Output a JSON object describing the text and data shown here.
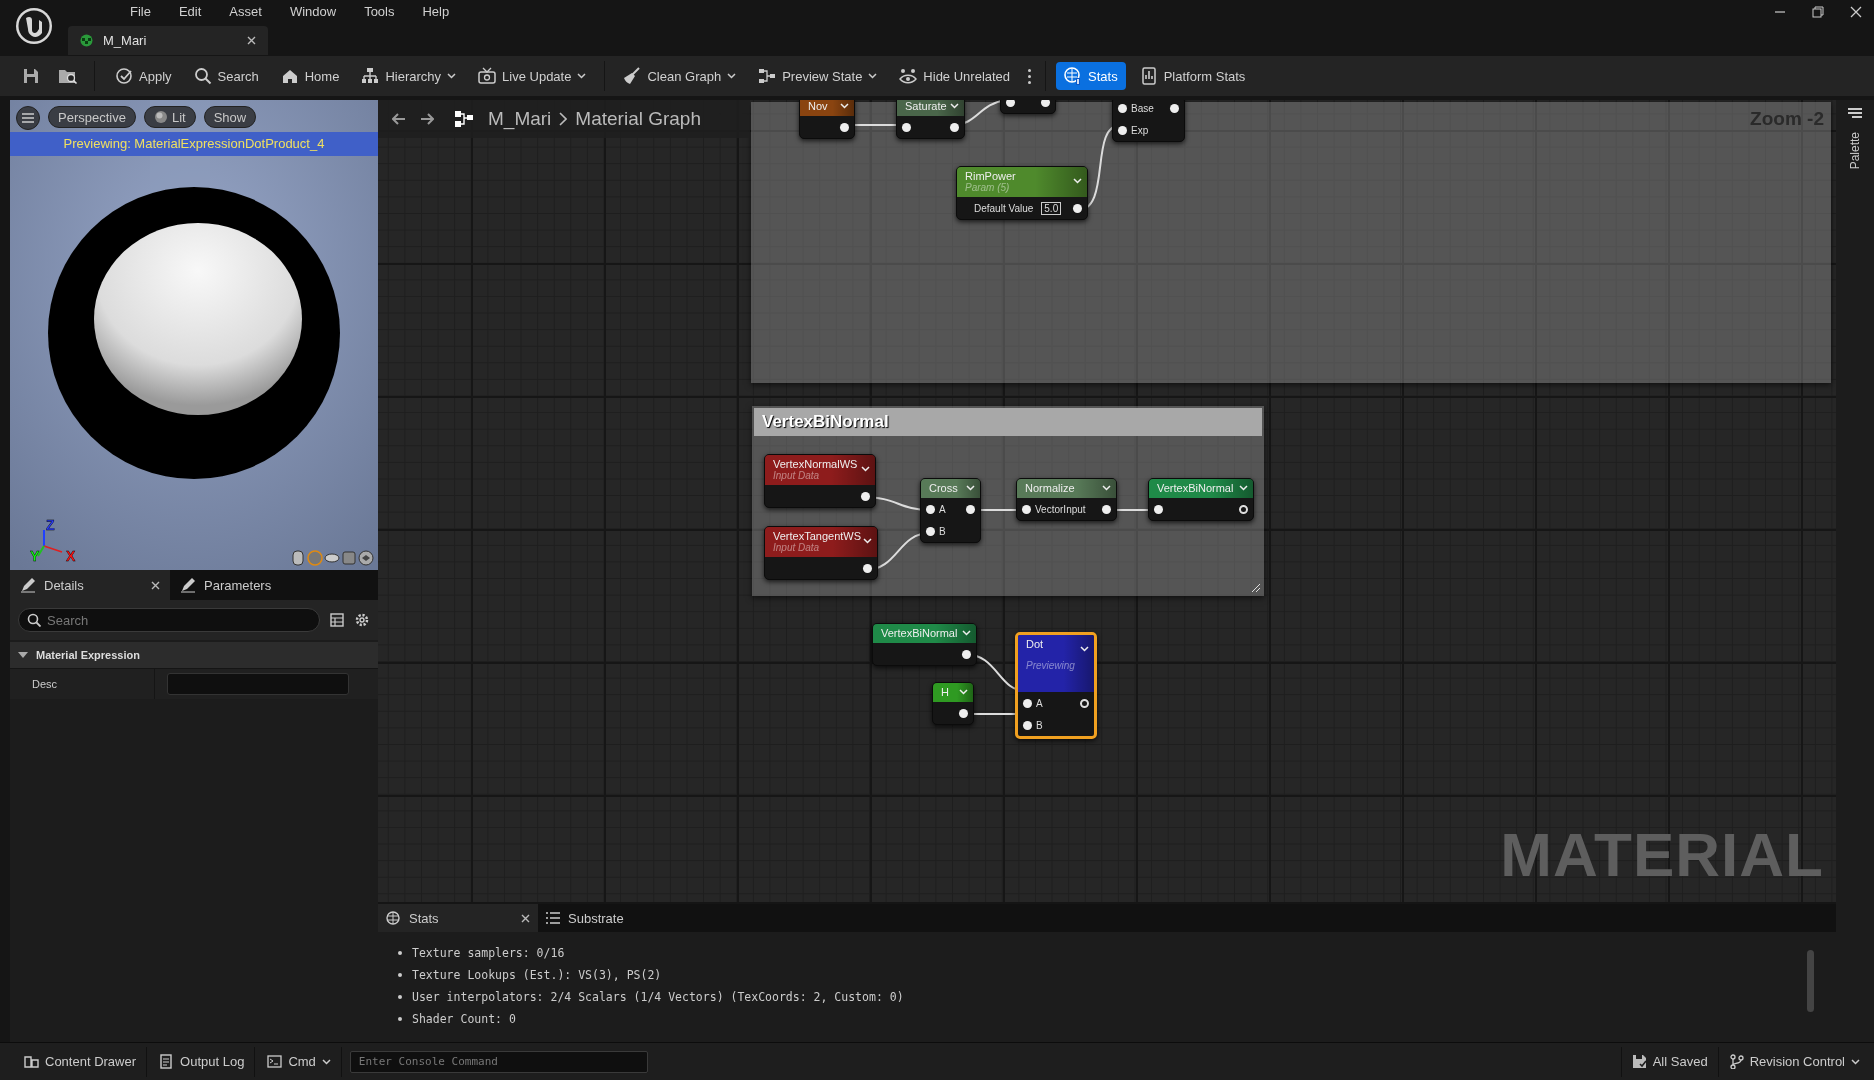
{
  "menu": [
    {
      "label": "File"
    },
    {
      "label": "Edit"
    },
    {
      "label": "Asset"
    },
    {
      "label": "Window"
    },
    {
      "label": "Tools"
    },
    {
      "label": "Help"
    }
  ],
  "document_tab": {
    "label": "M_Mari",
    "selected": true
  },
  "toolbar": [
    {
      "label": "Apply",
      "dropdown": false,
      "selected": false
    },
    {
      "label": "Search",
      "dropdown": false,
      "selected": false
    },
    {
      "label": "Home",
      "dropdown": false,
      "selected": false
    },
    {
      "label": "Hierarchy",
      "dropdown": true,
      "selected": false
    },
    {
      "label": "Live Update",
      "dropdown": true,
      "selected": false
    },
    {
      "label": "Clean Graph",
      "dropdown": true,
      "selected": false
    },
    {
      "label": "Preview State",
      "dropdown": true,
      "selected": false
    },
    {
      "label": "Hide Unrelated",
      "dropdown": false,
      "selected": false
    },
    {
      "label": "Stats",
      "dropdown": false,
      "selected": true
    },
    {
      "label": "Platform Stats",
      "dropdown": false,
      "selected": false
    }
  ],
  "viewport": {
    "buttons": [
      {
        "label": "Perspective"
      },
      {
        "label": "Lit"
      },
      {
        "label": "Show"
      }
    ],
    "preview_label": "Previewing: MaterialExpressionDotProduct_4",
    "axis_labels": [
      "Z",
      "Y",
      "X"
    ]
  },
  "details": {
    "tabs": [
      {
        "label": "Details",
        "selected": true
      },
      {
        "label": "Parameters",
        "selected": false
      }
    ],
    "search": {
      "placeholder": "Search"
    },
    "section": {
      "label": "Material Expression",
      "expanded": true
    },
    "properties": [
      {
        "label": "Desc"
      }
    ]
  },
  "graph": {
    "breadcrumb": [
      "M_Mari",
      "Material Graph"
    ],
    "zoom": "Zoom -2",
    "watermark": "MATERIAL",
    "comments": [
      {
        "kind": "untitled"
      },
      {
        "kind": "titled",
        "title": "VertexBiNormal"
      }
    ],
    "nodes": [
      {
        "title": "Nov",
        "color": "#8a4410",
        "selected": false,
        "rows": [
          {
            "output": true,
            "output_linked": true
          }
        ]
      },
      {
        "title": "Saturate",
        "color": "#4a664a",
        "selected": false,
        "rows": [
          {
            "input": true,
            "output": true,
            "output_linked": true
          }
        ]
      },
      {
        "selected": false,
        "rows": [
          {
            "input": true,
            "output": true,
            "output_linked": true
          }
        ]
      },
      {
        "selected": false,
        "rows": [
          {
            "input": true,
            "label": "Base",
            "output": true,
            "output_linked": true
          },
          {
            "input": true,
            "label": "Exp"
          }
        ]
      },
      {
        "title": "RimPower",
        "subtitle": "Param (5)",
        "color": "#4f8a2c",
        "selected": false,
        "rows": [
          {
            "field": "Default Value",
            "value": "5.0",
            "output": true,
            "output_linked": true
          }
        ]
      },
      {
        "title": "VertexNormalWS",
        "subtitle": "Input Data",
        "color": "#8e1c1c",
        "selected": false,
        "rows": [
          {
            "output": true,
            "output_linked": true
          }
        ]
      },
      {
        "title": "VertexTangentWS",
        "subtitle": "Input Data",
        "color": "#8e1c1c",
        "selected": false,
        "rows": [
          {
            "output": true,
            "output_linked": true
          }
        ]
      },
      {
        "title": "Cross",
        "color": "#587a58",
        "selected": false,
        "rows": [
          {
            "input": true,
            "label": "A",
            "output": true,
            "output_linked": true
          },
          {
            "input": true,
            "label": "B"
          }
        ]
      },
      {
        "title": "Normalize",
        "color": "#587a58",
        "selected": false,
        "rows": [
          {
            "input": true,
            "label": "VectorInput",
            "output": true,
            "output_linked": true
          }
        ]
      },
      {
        "title": "VertexBiNormal",
        "color": "#1f8a48",
        "selected": false,
        "rows": [
          {
            "input": true,
            "output": true,
            "output_linked": false
          }
        ]
      },
      {
        "title": "VertexBiNormal",
        "color": "#1f8a48",
        "selected": false,
        "rows": [
          {
            "output": true,
            "output_linked": true
          }
        ]
      },
      {
        "title": "H",
        "color": "#2f9a22",
        "selected": false,
        "rows": [
          {
            "output": true,
            "output_linked": true
          }
        ]
      },
      {
        "title": "Dot",
        "subtitle": "Previewing",
        "color": "#2323a8",
        "selected": true,
        "rows": [
          {
            "input": true,
            "label": "A",
            "output": true,
            "output_linked": false
          },
          {
            "input": true,
            "label": "B"
          }
        ]
      }
    ]
  },
  "palette": {
    "label": "Palette"
  },
  "stats_panel": {
    "tabs": [
      {
        "label": "Stats",
        "selected": true
      },
      {
        "label": "Substrate",
        "selected": false
      }
    ],
    "lines": [
      "Texture samplers: 0/16",
      "Texture Lookups (Est.): VS(3), PS(2)",
      "User interpolators: 2/4 Scalars (1/4 Vectors) (TexCoords: 2, Custom: 0)",
      "Shader Count: 0"
    ]
  },
  "status_bar": {
    "left": [
      {
        "label": "Content Drawer",
        "dropdown": false
      },
      {
        "label": "Output Log",
        "dropdown": false
      },
      {
        "label": "Cmd",
        "dropdown": true
      }
    ],
    "console": {
      "placeholder": "Enter Console Command"
    },
    "right": [
      {
        "label": "All Saved",
        "dropdown": false
      },
      {
        "label": "Revision Control",
        "dropdown": true
      }
    ]
  }
}
